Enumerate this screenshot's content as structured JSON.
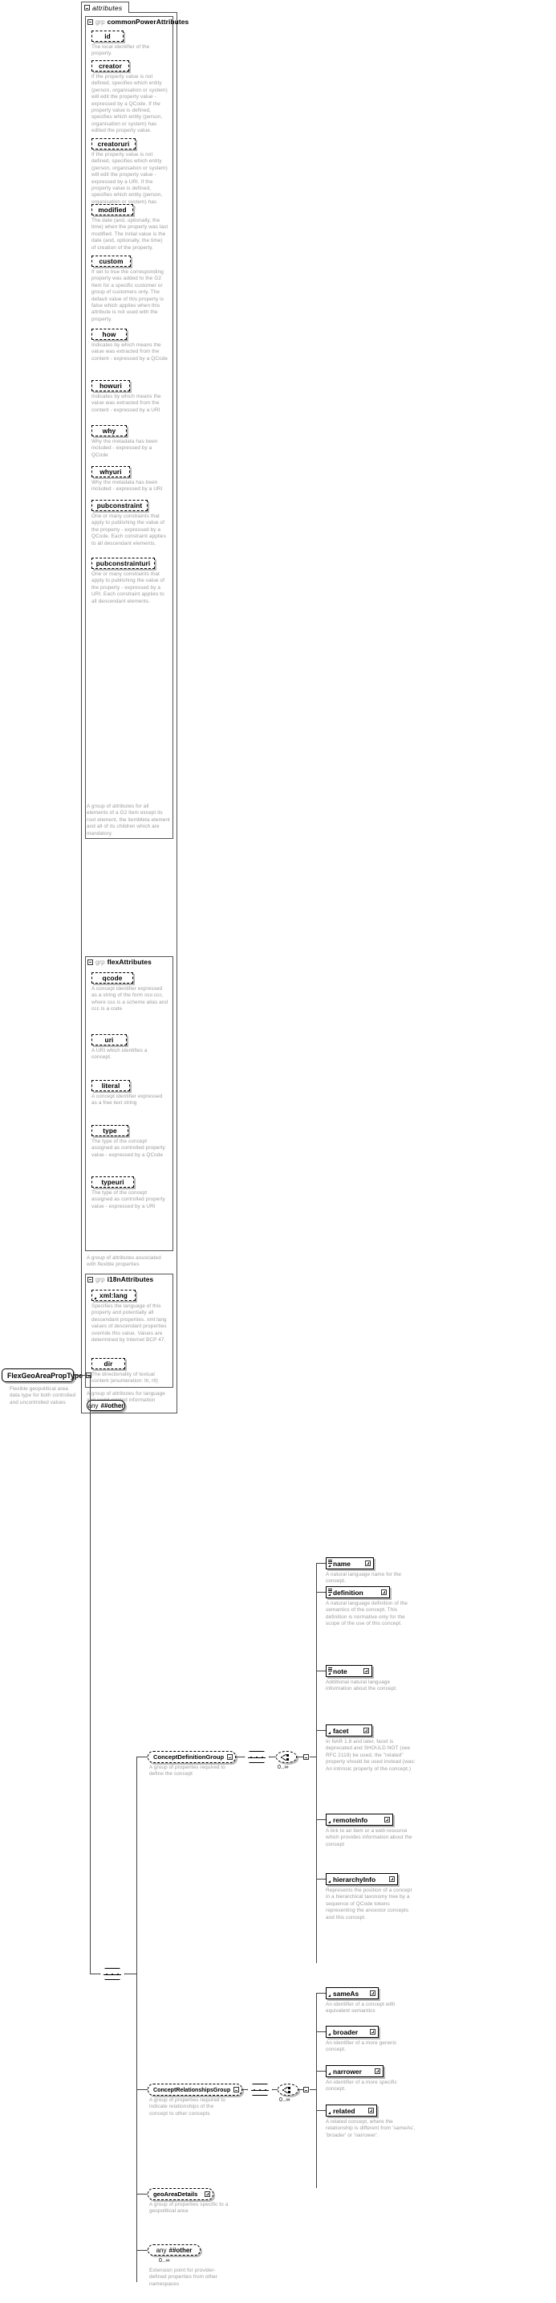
{
  "diagram": {
    "type": "xsd-schema-diagram",
    "root": {
      "name": "FlexGeoAreaPropType",
      "doc": "Flexible geopolitical area data type for both controlled and uncontrolled values",
      "toggle": "minus"
    },
    "attributes_tab": {
      "label": "attributes",
      "toggle": "minus"
    },
    "groups": [
      {
        "kw": "grp",
        "name": "commonPowerAttributes",
        "toggle": "minus",
        "footer": "A group of attributes for all elements of a G2 Item except its root element, the itemMeta element and all of its children which are mandatory.",
        "attributes": [
          {
            "name": "id",
            "doc": "The local identifier of the property."
          },
          {
            "name": "creator",
            "doc": "If the property value is not defined, specifies which entity (person, organisation or system) will edit the property value - expressed by a QCode. If the property value is defined, specifies which entity (person, organisation or system) has edited the property value."
          },
          {
            "name": "creatoruri",
            "doc": "If the property value is not defined, specifies which entity (person, organisation or system) will edit the property value - expressed by a URI. If the property value is defined, specifies which entity (person, organisation or system) has edited the property."
          },
          {
            "name": "modified",
            "doc": "The date (and, optionally, the time) when the property was last modified. The initial value is the date (and, optionally, the time) of creation of the property."
          },
          {
            "name": "custom",
            "doc": "If set to true the corresponding property was added to the G2 Item for a specific customer or group of customers only. The default value of this property is false which applies when this attribute is not used with the property."
          },
          {
            "name": "how",
            "doc": "Indicates by which means the value was extracted from the content - expressed by a QCode"
          },
          {
            "name": "howuri",
            "doc": "Indicates by which means the value was extracted from the content - expressed by a URI"
          },
          {
            "name": "why",
            "doc": "Why the metadata has been included - expressed by a QCode"
          },
          {
            "name": "whyuri",
            "doc": "Why the metadata has been included - expressed by a URI"
          },
          {
            "name": "pubconstraint",
            "doc": "One or many constraints that apply to publishing the value of the property - expressed by a QCode. Each constraint applies to all descendant elements."
          },
          {
            "name": "pubconstrainturi",
            "doc": "One or many constraints that apply to publishing the value of the property - expressed by a URI. Each constraint applies to all descendant elements."
          }
        ]
      },
      {
        "kw": "grp",
        "name": "flexAttributes",
        "toggle": "minus",
        "footer": "A group of attributes associated with flexible properties",
        "attributes": [
          {
            "name": "qcode",
            "doc": "A concept identifier expressed as a string of the form sss:ccc, where sss is a scheme alias and ccc is a code"
          },
          {
            "name": "uri",
            "doc": "A URI which identifies a concept."
          },
          {
            "name": "literal",
            "doc": "A concept identifier expressed as a free text string"
          },
          {
            "name": "type",
            "doc": "The type of the concept assigned as controlled property value - expressed by a QCode"
          },
          {
            "name": "typeuri",
            "doc": "The type of the concept assigned as controlled property value - expressed by a URI"
          }
        ]
      },
      {
        "kw": "grp",
        "name": "i18nAttributes",
        "toggle": "minus",
        "footer": "A group of attributes for language and script related information",
        "attributes": [
          {
            "name": "xml:lang",
            "doc": "Specifies the language of this property and potentially all descendant properties. xml:lang values of descendant properties override this value. Values are determined by Internet BCP 47."
          },
          {
            "name": "dir",
            "doc": "The directionality of textual content (enumeration: ltr, rtl)"
          }
        ]
      }
    ],
    "any_attribute": {
      "label": "any",
      "namespace": "##other"
    },
    "content_model": {
      "root_connector": "sequence",
      "branches": [
        {
          "kind": "group-ref",
          "name": "ConceptDefinitionGroup",
          "doc": "A group of properites required to define the concept",
          "connector": "sequence",
          "choice": "choice",
          "occurs": "0..∞",
          "elements": [
            {
              "name": "name",
              "doc": "A natural language name for the concept.",
              "toggle": "plus",
              "glyphs": [
                "lines",
                "arrow"
              ]
            },
            {
              "name": "definition",
              "doc": "A natural language definition of the semantics of the concept. This definition is normative only for the scope of the use of this concept.",
              "toggle": "plus",
              "glyphs": [
                "lines",
                "arrow"
              ]
            },
            {
              "name": "note",
              "doc": "Additional natural language information about the concept.",
              "toggle": "plus",
              "glyphs": [
                "lines",
                "arrow"
              ]
            },
            {
              "name": "facet",
              "doc": "In NAR 1.8 and later, facet is deprecated and SHOULD NOT (see RFC 2119) be used, the \"related\" property should be used instead (was: An intrinsic property of the concept.)",
              "toggle": "plus",
              "glyphs": [
                "arrow"
              ]
            },
            {
              "name": "remoteInfo",
              "doc": "A link to an item or a web resource which provides information about the concept",
              "toggle": "plus",
              "glyphs": [
                "arrow"
              ]
            },
            {
              "name": "hierarchyInfo",
              "doc": "Represents the position of a concept in a hierarchical taxonomy tree by a sequence of QCode tokens representing the ancestor concepts and this concept.",
              "toggle": "plus",
              "glyphs": [
                "arrow"
              ]
            }
          ]
        },
        {
          "kind": "group-ref",
          "name": "ConceptRelationshipsGroup",
          "doc": "A group of properties required to indicate relationships of the concept to other concepts",
          "connector": "sequence",
          "choice": "choice",
          "occurs": "0..∞",
          "elements": [
            {
              "name": "sameAs",
              "doc": "An identifier of a concept with equivalent semantics",
              "toggle": "plus",
              "glyphs": [
                "arrow"
              ]
            },
            {
              "name": "broader",
              "doc": "An identifier of a more generic concept.",
              "toggle": "plus",
              "glyphs": [
                "arrow"
              ]
            },
            {
              "name": "narrower",
              "doc": "An identifier of a more specific concept.",
              "toggle": "plus",
              "glyphs": [
                "arrow"
              ]
            },
            {
              "name": "related",
              "doc": "A related concept, where the relationship is different from 'sameAs', 'broader' or 'narrower'.",
              "toggle": "plus",
              "glyphs": [
                "arrow"
              ]
            }
          ]
        },
        {
          "kind": "group-ref",
          "name": "geoAreaDetails",
          "doc": "A group of properties specific to a geopolitical area",
          "toggle": "plus"
        },
        {
          "kind": "any",
          "label": "any",
          "namespace": "##other",
          "occurs": "0..∞",
          "doc": "Extension point for provider-defined properties from other namespaces"
        }
      ]
    }
  }
}
